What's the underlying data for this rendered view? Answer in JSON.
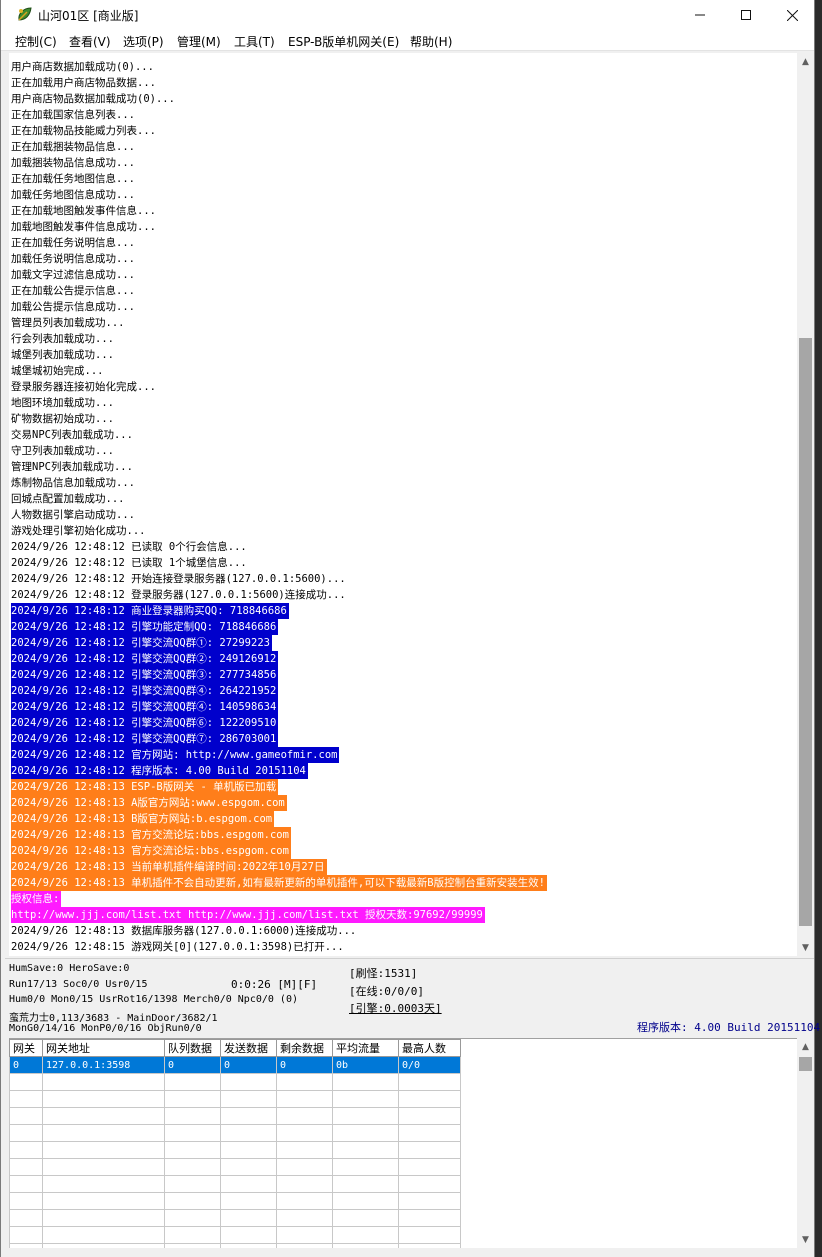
{
  "window": {
    "title": "山河01区 [商业版]",
    "icon": "app-leaf-icon"
  },
  "menu": [
    "控制(C)",
    "查看(V)",
    "选项(P)",
    "管理(M)",
    "工具(T)",
    "ESP-B版单机网关(E)",
    "帮助(H)"
  ],
  "log": [
    {
      "text": "用户商店数据加载成功(0)...",
      "style": ""
    },
    {
      "text": "正在加载用户商店物品数据...",
      "style": ""
    },
    {
      "text": "用户商店物品数据加载成功(0)...",
      "style": ""
    },
    {
      "text": "正在加载国家信息列表...",
      "style": ""
    },
    {
      "text": "正在加载物品技能威力列表...",
      "style": ""
    },
    {
      "text": "正在加载捆装物品信息...",
      "style": ""
    },
    {
      "text": "加载捆装物品信息成功...",
      "style": ""
    },
    {
      "text": "正在加载任务地图信息...",
      "style": ""
    },
    {
      "text": "加载任务地图信息成功...",
      "style": ""
    },
    {
      "text": "正在加载地图触发事件信息...",
      "style": ""
    },
    {
      "text": "加载地图触发事件信息成功...",
      "style": ""
    },
    {
      "text": "正在加载任务说明信息...",
      "style": ""
    },
    {
      "text": "加载任务说明信息成功...",
      "style": ""
    },
    {
      "text": "加载文字过滤信息成功...",
      "style": ""
    },
    {
      "text": "正在加载公告提示信息...",
      "style": ""
    },
    {
      "text": "加载公告提示信息成功...",
      "style": ""
    },
    {
      "text": "管理员列表加载成功...",
      "style": ""
    },
    {
      "text": "行会列表加载成功...",
      "style": ""
    },
    {
      "text": "城堡列表加载成功...",
      "style": ""
    },
    {
      "text": "城堡城初始完成...",
      "style": ""
    },
    {
      "text": "登录服务器连接初始化完成...",
      "style": ""
    },
    {
      "text": "地图环境加载成功...",
      "style": ""
    },
    {
      "text": "矿物数据初始成功...",
      "style": ""
    },
    {
      "text": "交易NPC列表加载成功...",
      "style": ""
    },
    {
      "text": "守卫列表加载成功...",
      "style": ""
    },
    {
      "text": "管理NPC列表加载成功...",
      "style": ""
    },
    {
      "text": "炼制物品信息加载成功...",
      "style": ""
    },
    {
      "text": "回城点配置加载成功...",
      "style": ""
    },
    {
      "text": "人物数据引擎启动成功...",
      "style": ""
    },
    {
      "text": "游戏处理引擎初始化成功...",
      "style": ""
    },
    {
      "text": "2024/9/26 12:48:12 已读取 0个行会信息...",
      "style": ""
    },
    {
      "text": "2024/9/26 12:48:12 已读取 1个城堡信息...",
      "style": ""
    },
    {
      "text": "2024/9/26 12:48:12 开始连接登录服务器(127.0.0.1:5600)...",
      "style": ""
    },
    {
      "text": "2024/9/26 12:48:12 登录服务器(127.0.0.1:5600)连接成功...",
      "style": ""
    },
    {
      "text": "2024/9/26 12:48:12 商业登录器购买QQ: 718846686",
      "style": "blue"
    },
    {
      "text": "2024/9/26 12:48:12 引擎功能定制QQ: 718846686",
      "style": "blue"
    },
    {
      "text": "2024/9/26 12:48:12 引擎交流QQ群①: 27299223",
      "style": "blue"
    },
    {
      "text": "2024/9/26 12:48:12 引擎交流QQ群②: 249126912",
      "style": "blue"
    },
    {
      "text": "2024/9/26 12:48:12 引擎交流QQ群③: 277734856",
      "style": "blue"
    },
    {
      "text": "2024/9/26 12:48:12 引擎交流QQ群④: 264221952",
      "style": "blue"
    },
    {
      "text": "2024/9/26 12:48:12 引擎交流QQ群④: 140598634",
      "style": "blue"
    },
    {
      "text": "2024/9/26 12:48:12 引擎交流QQ群⑥: 122209510",
      "style": "blue"
    },
    {
      "text": "2024/9/26 12:48:12 引擎交流QQ群⑦: 286703001",
      "style": "blue"
    },
    {
      "text": "2024/9/26 12:48:12 官方网站: http://www.gameofmir.com",
      "style": "blue"
    },
    {
      "text": "2024/9/26 12:48:12 程序版本: 4.00 Build 20151104",
      "style": "blue"
    },
    {
      "text": "2024/9/26 12:48:13 ESP-B版网关 - 单机版已加载",
      "style": "orange"
    },
    {
      "text": "2024/9/26 12:48:13 A版官方网站:www.espgom.com",
      "style": "orange"
    },
    {
      "text": "2024/9/26 12:48:13 B版官方网站:b.espgom.com",
      "style": "orange"
    },
    {
      "text": "2024/9/26 12:48:13 官方交流论坛:bbs.espgom.com",
      "style": "orange"
    },
    {
      "text": "2024/9/26 12:48:13 官方交流论坛:bbs.espgom.com",
      "style": "orange"
    },
    {
      "text": "2024/9/26 12:48:13 当前单机插件编译时间:2022年10月27日",
      "style": "orange"
    },
    {
      "text": "2024/9/26 12:48:13 单机插件不会自动更新,如有最新更新的单机插件,可以下载最新B版控制台重新安装生效!",
      "style": "orange"
    },
    {
      "text": "授权信息:",
      "style": "magenta"
    },
    {
      "text": "http://www.jjj.com/list.txt http://www.jjj.com/list.txt 授权天数:97692/99999",
      "style": "magenta"
    },
    {
      "text": "2024/9/26 12:48:13 数据库服务器(127.0.0.1:6000)连接成功...",
      "style": ""
    },
    {
      "text": "2024/9/26 12:48:15 游戏网关[0](127.0.0.1:3598)已打开...",
      "style": ""
    }
  ],
  "status": {
    "line1": "HumSave:0 HeroSave:0",
    "line2": "Run17/13 Soc0/0 Usr0/15",
    "timer": "0:0:26 [M][F]",
    "line3": "Hum0/0 Mon0/15 UsrRot16/1398 Merch0/0 Npc0/0 (0)",
    "line4": "蛮荒力士0,113/3683 - MainDoor/3682/1",
    "line5": "MonG0/14/16 MonP0/0/16 ObjRun0/0",
    "refresh": "[刷怪:1531]",
    "online": "[在线:0/0/0]",
    "engine": "[引擎:0.0003天]",
    "version": "程序版本: 4.00 Build 20151104"
  },
  "gateway_table": {
    "headers": [
      "网关",
      "网关地址",
      "队列数据",
      "发送数据",
      "剩余数据",
      "平均流量",
      "最高人数"
    ],
    "rows": [
      [
        "0",
        "127.0.0.1:3598",
        "0",
        "0",
        "0",
        "0b",
        "0/0"
      ]
    ]
  }
}
